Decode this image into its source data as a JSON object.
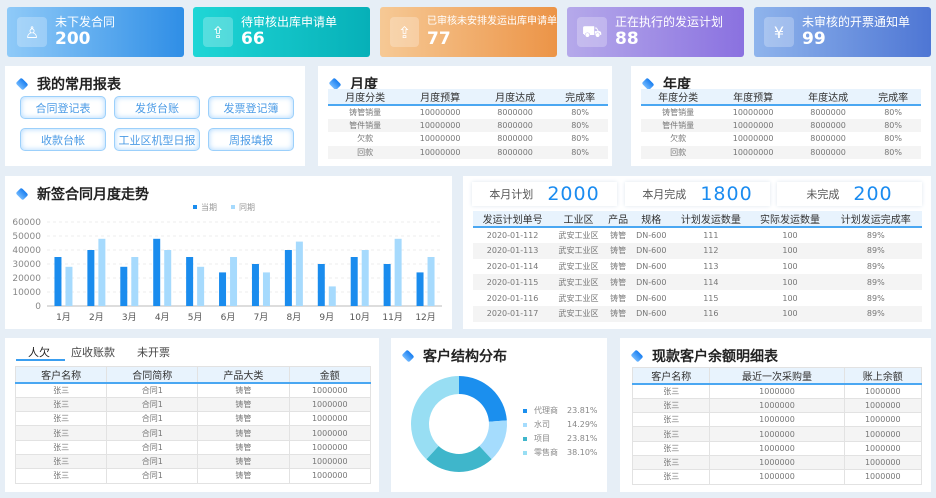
{
  "kpis": [
    {
      "label": "未下发合同",
      "value": "200",
      "icon": "stamp-icon",
      "c1": "#8fcaf8",
      "c2": "#2f8ee6"
    },
    {
      "label": "待审核出库申请单",
      "value": "66",
      "icon": "outbox-icon",
      "c1": "#1fd6d6",
      "c2": "#06b0b8"
    },
    {
      "label": "已审核未安排发运出库申请单",
      "value": "77",
      "icon": "outbox-icon",
      "c1": "#f6c995",
      "c2": "#ec9447"
    },
    {
      "label": "正在执行的发运计划",
      "value": "88",
      "icon": "truck-icon",
      "c1": "#b5a9ea",
      "c2": "#8a71e0"
    },
    {
      "label": "未审核的开票通知单",
      "value": "99",
      "icon": "invoice-icon",
      "c1": "#8fb4ec",
      "c2": "#4e76d4"
    }
  ],
  "reports": {
    "title": "我的常用报表",
    "buttons": [
      "合同登记表",
      "发货台账",
      "发票登记簿",
      "收款台帐",
      "工业区机型日报",
      "周报填报"
    ]
  },
  "monthly": {
    "title": "月度",
    "headers": [
      "月度分类",
      "月度预算",
      "月度达成",
      "完成率"
    ],
    "rows": [
      [
        "铸管销量",
        "10000000",
        "8000000",
        "80%"
      ],
      [
        "管件销量",
        "10000000",
        "8000000",
        "80%"
      ],
      [
        "欠款",
        "10000000",
        "8000000",
        "80%"
      ],
      [
        "回款",
        "10000000",
        "8000000",
        "80%"
      ]
    ]
  },
  "yearly": {
    "title": "年度",
    "headers": [
      "年度分类",
      "年度预算",
      "年度达成",
      "完成率"
    ],
    "rows": [
      [
        "铸管销量",
        "10000000",
        "8000000",
        "80%"
      ],
      [
        "管件销量",
        "10000000",
        "8000000",
        "80%"
      ],
      [
        "欠款",
        "10000000",
        "8000000",
        "80%"
      ],
      [
        "回款",
        "10000000",
        "8000000",
        "80%"
      ]
    ]
  },
  "chart_data": {
    "type": "bar",
    "title": "新签合同月度走势",
    "categories": [
      "1月",
      "2月",
      "3月",
      "4月",
      "5月",
      "6月",
      "7月",
      "8月",
      "9月",
      "10月",
      "11月",
      "12月"
    ],
    "series": [
      {
        "name": "当期",
        "color": "#1a8cee",
        "values": [
          35000,
          40000,
          28000,
          48000,
          35000,
          24000,
          30000,
          40000,
          30000,
          35000,
          30000,
          24000
        ]
      },
      {
        "name": "同期",
        "color": "#a6dafd",
        "values": [
          28000,
          48000,
          35000,
          40000,
          28000,
          35000,
          24000,
          46000,
          14000,
          40000,
          48000,
          35000
        ]
      }
    ],
    "ylim": [
      0,
      60000
    ],
    "yticks": [
      0,
      10000,
      20000,
      30000,
      40000,
      50000,
      60000
    ],
    "legend": "top-center",
    "grid": true
  },
  "shipping": {
    "stats": [
      {
        "label": "本月计划",
        "value": "2000"
      },
      {
        "label": "本月完成",
        "value": "1800"
      },
      {
        "label": "未完成",
        "value": "200"
      }
    ],
    "headers": [
      "发运计划单号",
      "工业区",
      "产品",
      "规格",
      "计划发运数量",
      "实际发运数量",
      "计划发运完成率"
    ],
    "rows": [
      [
        "2020-01-112",
        "武安工业区",
        "铸管",
        "DN-600",
        "111",
        "100",
        "89%"
      ],
      [
        "2020-01-113",
        "武安工业区",
        "铸管",
        "DN-600",
        "112",
        "100",
        "89%"
      ],
      [
        "2020-01-114",
        "武安工业区",
        "铸管",
        "DN-600",
        "113",
        "100",
        "89%"
      ],
      [
        "2020-01-115",
        "武安工业区",
        "铸管",
        "DN-600",
        "114",
        "100",
        "89%"
      ],
      [
        "2020-01-116",
        "武安工业区",
        "铸管",
        "DN-600",
        "115",
        "100",
        "89%"
      ],
      [
        "2020-01-117",
        "武安工业区",
        "铸管",
        "DN-600",
        "116",
        "100",
        "89%"
      ]
    ]
  },
  "debts": {
    "tabs": [
      "人欠",
      "应收账款",
      "未开票"
    ],
    "headers": [
      "客户名称",
      "合同简称",
      "产品大类",
      "金额"
    ],
    "rows": [
      [
        "张三",
        "合同1",
        "铸管",
        "1000000"
      ],
      [
        "张三",
        "合同1",
        "铸管",
        "1000000"
      ],
      [
        "张三",
        "合同1",
        "铸管",
        "1000000"
      ],
      [
        "张三",
        "合同1",
        "铸管",
        "1000000"
      ],
      [
        "张三",
        "合同1",
        "铸管",
        "1000000"
      ],
      [
        "张三",
        "合同1",
        "铸管",
        "1000000"
      ],
      [
        "张三",
        "合同1",
        "铸管",
        "1000000"
      ]
    ]
  },
  "customers": {
    "title": "客户结构分布",
    "slices": [
      {
        "name": "代理商",
        "pct": "23.81%",
        "value": 23.81,
        "color": "#1b8fee"
      },
      {
        "name": "水司",
        "pct": "14.29%",
        "value": 14.29,
        "color": "#a5dcfd"
      },
      {
        "name": "项目",
        "pct": "23.81%",
        "value": 23.81,
        "color": "#3fb6cb"
      },
      {
        "name": "零售商",
        "pct": "38.10%",
        "value": 38.1,
        "color": "#98def3"
      }
    ]
  },
  "balances": {
    "title": "现款客户余额明细表",
    "headers": [
      "客户名称",
      "最近一次采购量",
      "账上余额"
    ],
    "rows": [
      [
        "张三",
        "1000000",
        "1000000"
      ],
      [
        "张三",
        "1000000",
        "1000000"
      ],
      [
        "张三",
        "1000000",
        "1000000"
      ],
      [
        "张三",
        "1000000",
        "1000000"
      ],
      [
        "张三",
        "1000000",
        "1000000"
      ],
      [
        "张三",
        "1000000",
        "1000000"
      ],
      [
        "张三",
        "1000000",
        "1000000"
      ]
    ]
  }
}
